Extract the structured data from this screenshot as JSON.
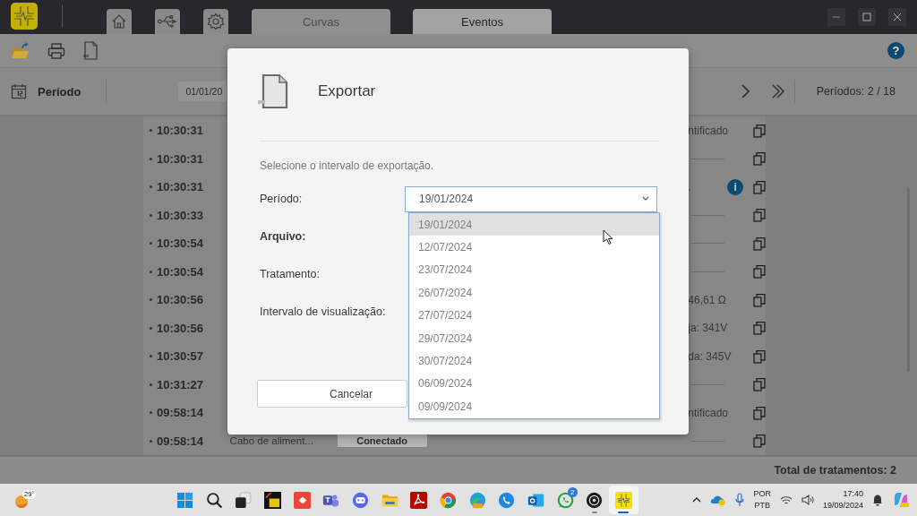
{
  "titlebar": {
    "tabs": [
      {
        "label": "Curvas",
        "selected": false
      },
      {
        "label": "Eventos",
        "selected": true
      }
    ]
  },
  "toolbar": {
    "help": "?"
  },
  "period_bar": {
    "label": "Período",
    "start_date": "01/01/20",
    "periods": "Períodos: 2 / 18"
  },
  "events": [
    {
      "time": "10:30:31",
      "detail": "ntificado"
    },
    {
      "time": "10:30:31"
    },
    {
      "time": "10:30:31",
      "detail": ".",
      "info": "i"
    },
    {
      "time": "10:30:33"
    },
    {
      "time": "10:30:54"
    },
    {
      "time": "10:30:54"
    },
    {
      "time": "10:30:56",
      "detail": "46,61 Ω"
    },
    {
      "time": "10:30:56",
      "detail": "ja: 341V"
    },
    {
      "time": "10:30:57",
      "detail": "da: 345V"
    },
    {
      "time": "10:31:27"
    },
    {
      "time": "09:58:14",
      "detail": "ntificado"
    },
    {
      "time": "09:58:14",
      "description": "Cabo de aliment...",
      "status": "Conectado"
    }
  ],
  "footer": {
    "total": "Total de tratamentos: 2"
  },
  "dialog": {
    "title": "Exportar",
    "instruction": "Selecione o intervalo de exportação.",
    "fields": [
      {
        "label": "Período:",
        "bold": false,
        "value": "19/01/2024"
      },
      {
        "label": "Arquivo:",
        "bold": true
      },
      {
        "label": "Tratamento:",
        "bold": false
      },
      {
        "label": "Intervalo de visualização:",
        "bold": false
      }
    ],
    "options": [
      {
        "label": "19/01/2024",
        "selected": true
      },
      {
        "label": "12/07/2024",
        "selected": false
      },
      {
        "label": "23/07/2024",
        "selected": false
      },
      {
        "label": "26/07/2024",
        "selected": false
      },
      {
        "label": "27/07/2024",
        "selected": false
      },
      {
        "label": "29/07/2024",
        "selected": false
      },
      {
        "label": "30/07/2024",
        "selected": false
      },
      {
        "label": "06/09/2024",
        "selected": false
      },
      {
        "label": "09/09/2024",
        "selected": false
      }
    ],
    "buttons": [
      {
        "label": "Cancelar"
      }
    ]
  },
  "taskbar": {
    "weather": "29°",
    "apps": [
      {
        "kind": "start",
        "running": false,
        "active": false
      },
      {
        "kind": "search",
        "running": false,
        "active": false
      },
      {
        "kind": "taskview",
        "running": false,
        "active": false
      },
      {
        "kind": "yellowapp",
        "running": false,
        "active": false
      },
      {
        "kind": "remote",
        "running": false,
        "active": false
      },
      {
        "kind": "team",
        "running": false,
        "active": false
      },
      {
        "kind": "chat",
        "running": false,
        "active": false
      },
      {
        "kind": "folder",
        "running": false,
        "active": false
      },
      {
        "kind": "document",
        "running": false,
        "active": false
      },
      {
        "kind": "browser",
        "running": false,
        "active": false
      },
      {
        "kind": "browser2",
        "running": false,
        "active": false
      },
      {
        "kind": "phone",
        "running": false,
        "active": false
      },
      {
        "kind": "mail",
        "running": false,
        "active": false
      },
      {
        "kind": "message",
        "running": false,
        "active": false,
        "badge": "2"
      },
      {
        "kind": "record",
        "running": true,
        "active": false
      },
      {
        "kind": "logo",
        "running": true,
        "active": true
      }
    ],
    "language": [
      "POR",
      "PTB"
    ],
    "time": "17:40",
    "date": "19/09/2024"
  }
}
